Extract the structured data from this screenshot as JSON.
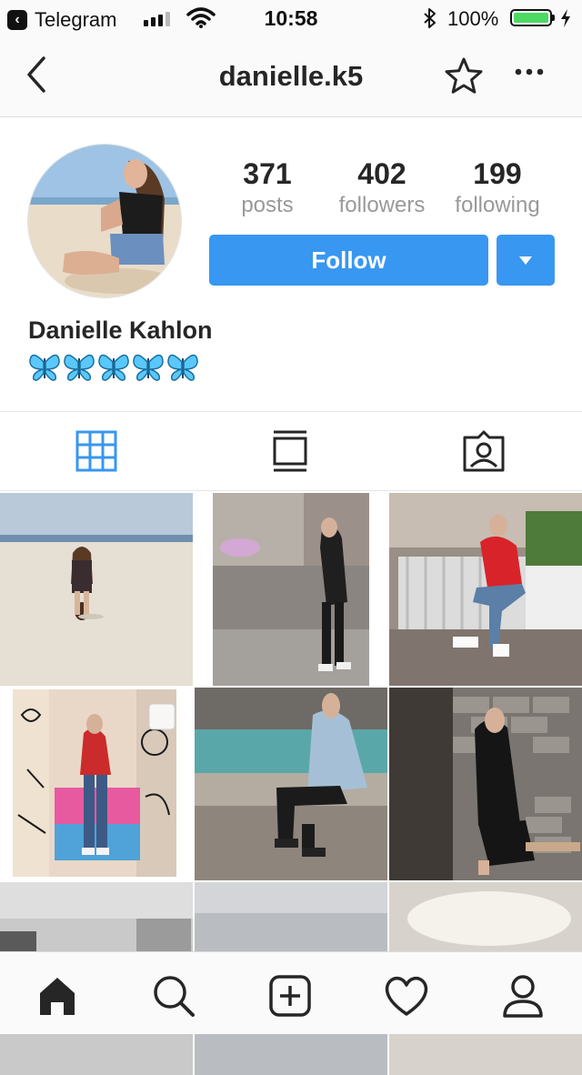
{
  "status_bar": {
    "back_app": "Telegram",
    "time": "10:58",
    "battery": "100%"
  },
  "nav": {
    "username": "danielle.k5",
    "back_icon": "chevron-left-icon",
    "favorite_icon": "star-icon",
    "more_icon": "more-horizontal-icon"
  },
  "profile": {
    "stats": [
      {
        "value": "371",
        "label": "posts"
      },
      {
        "value": "402",
        "label": "followers"
      },
      {
        "value": "199",
        "label": "following"
      }
    ],
    "follow_label": "Follow",
    "full_name": "Danielle Kahlon",
    "bio_icons": [
      "butterfly-icon",
      "butterfly-icon",
      "butterfly-icon",
      "butterfly-icon",
      "butterfly-icon"
    ]
  },
  "tabs": [
    {
      "name": "grid-icon",
      "active": true
    },
    {
      "name": "list-feed-icon",
      "active": false
    },
    {
      "name": "tagged-icon",
      "active": false
    }
  ],
  "posts": [
    "beach-photo",
    "street-photo",
    "bench-photo",
    "graffiti-photo",
    "fountain-photo",
    "brick-wall-photo",
    "sky-city-photo",
    "sky-cloud-photo",
    "sky-bright-photo"
  ],
  "bottom_bar": [
    "home-icon",
    "search-icon",
    "new-post-icon",
    "activity-heart-icon",
    "profile-icon"
  ],
  "colors": {
    "accent_blue": "#3897f0",
    "butterfly_blue": "#5ac8fa",
    "battery_green": "#4cd964"
  }
}
